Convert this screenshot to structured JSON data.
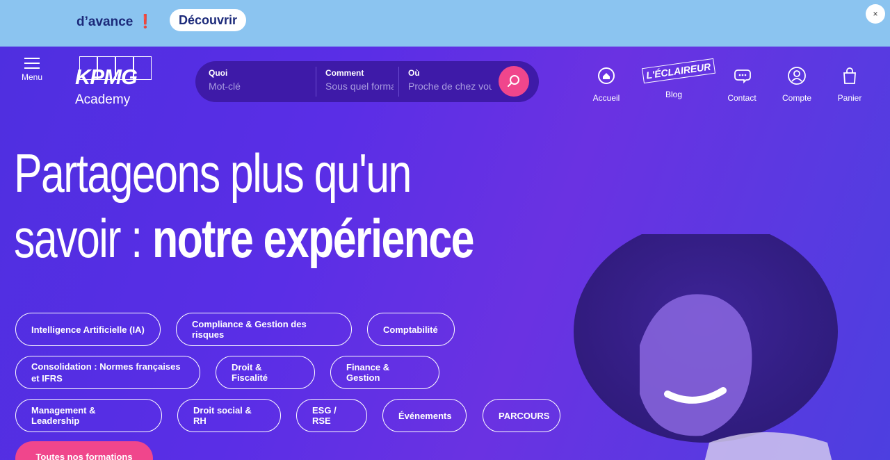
{
  "banner": {
    "text": "d’avance",
    "excl": "❗",
    "button": "Découvrir",
    "close": "×"
  },
  "header": {
    "menu_label": "Menu",
    "logo_brand": "KPMG",
    "logo_sub": "Academy",
    "search": {
      "quoi_label": "Quoi",
      "quoi_placeholder": "Mot-clé",
      "comment_label": "Comment",
      "comment_placeholder": "Sous quel format",
      "ou_label": "Où",
      "ou_placeholder": "Proche de chez vous"
    },
    "nav": [
      {
        "label": "Accueil",
        "icon": "home-icon"
      },
      {
        "label": "Blog",
        "icon": "eclaireur-logo",
        "logo_text": "L'ÉCLAIREUR"
      },
      {
        "label": "Contact",
        "icon": "chat-icon"
      },
      {
        "label": "Compte",
        "icon": "user-icon"
      },
      {
        "label": "Panier",
        "icon": "bag-icon"
      }
    ]
  },
  "hero": {
    "line1": "Partageons plus qu'un",
    "line2_light": "savoir : ",
    "line2_bold": "notre expérience",
    "categories": [
      "Intelligence Artificielle (IA)",
      "Compliance & Gestion des risques",
      "Comptabilité",
      "Consolidation : Normes françaises et IFRS",
      "Droit & Fiscalité",
      "Finance & Gestion",
      "Management & Leadership",
      "Droit social & RH",
      "ESG / RSE",
      "Événements",
      "PARCOURS"
    ],
    "cta": "Toutes nos formations"
  },
  "colors": {
    "banner_bg": "#8bc4f0",
    "hero_bg": "#5a2ee6",
    "search_bg": "#3e1aa8",
    "accent_pink": "#f0468c"
  }
}
